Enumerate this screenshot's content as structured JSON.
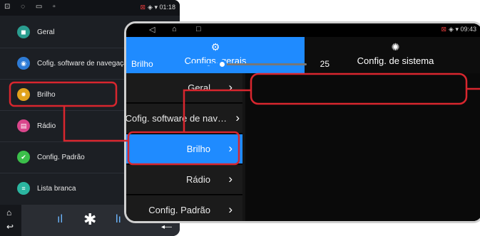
{
  "old_screen": {
    "status": {
      "left_icons": "⊡ ◌ ▭ ▫",
      "right_warn": "⊠",
      "right_text": "◈ ▾ 01:18"
    },
    "items": [
      {
        "label": "Geral",
        "color": "#2a9d8f",
        "glyph": "◼"
      },
      {
        "label": "Cofig. software de navegação",
        "color": "#2e7bd6",
        "glyph": "◉"
      },
      {
        "label": "Brilho",
        "color": "#e0a21c",
        "glyph": "✹"
      },
      {
        "label": "Rádio",
        "color": "#d9468b",
        "glyph": "▤"
      },
      {
        "label": "Config. Padrão",
        "color": "#3bbf4a",
        "glyph": "✔"
      },
      {
        "label": "Lista branca",
        "color": "#2bb5a0",
        "glyph": "≡"
      }
    ],
    "bottom": {
      "home": "⌂",
      "back": "↩",
      "prev": "ıl",
      "bluetooth": "✱",
      "next": "lı",
      "return": "◂—"
    }
  },
  "new_screen": {
    "status": {
      "back": "◁",
      "home": "⌂",
      "recent": "□",
      "right_warn": "⊠",
      "right_text": "◈ ▾ 09:43"
    },
    "tabs": [
      {
        "label": "Configs. gerais",
        "icon": "⚙"
      },
      {
        "label": "Config. de sistema",
        "icon": "✺"
      }
    ],
    "menu": [
      {
        "label": "Geral",
        "selected": false
      },
      {
        "label": "Cofig. software de nav…",
        "selected": false
      },
      {
        "label": "Brilho",
        "selected": true
      },
      {
        "label": "Rádio",
        "selected": false
      },
      {
        "label": "Config. Padrão",
        "selected": false
      }
    ],
    "brightness": {
      "label": "Brilho",
      "value": "25",
      "fraction": 0.28
    }
  },
  "colors": {
    "accent": "#1f8bff",
    "callout": "#d8262e"
  }
}
